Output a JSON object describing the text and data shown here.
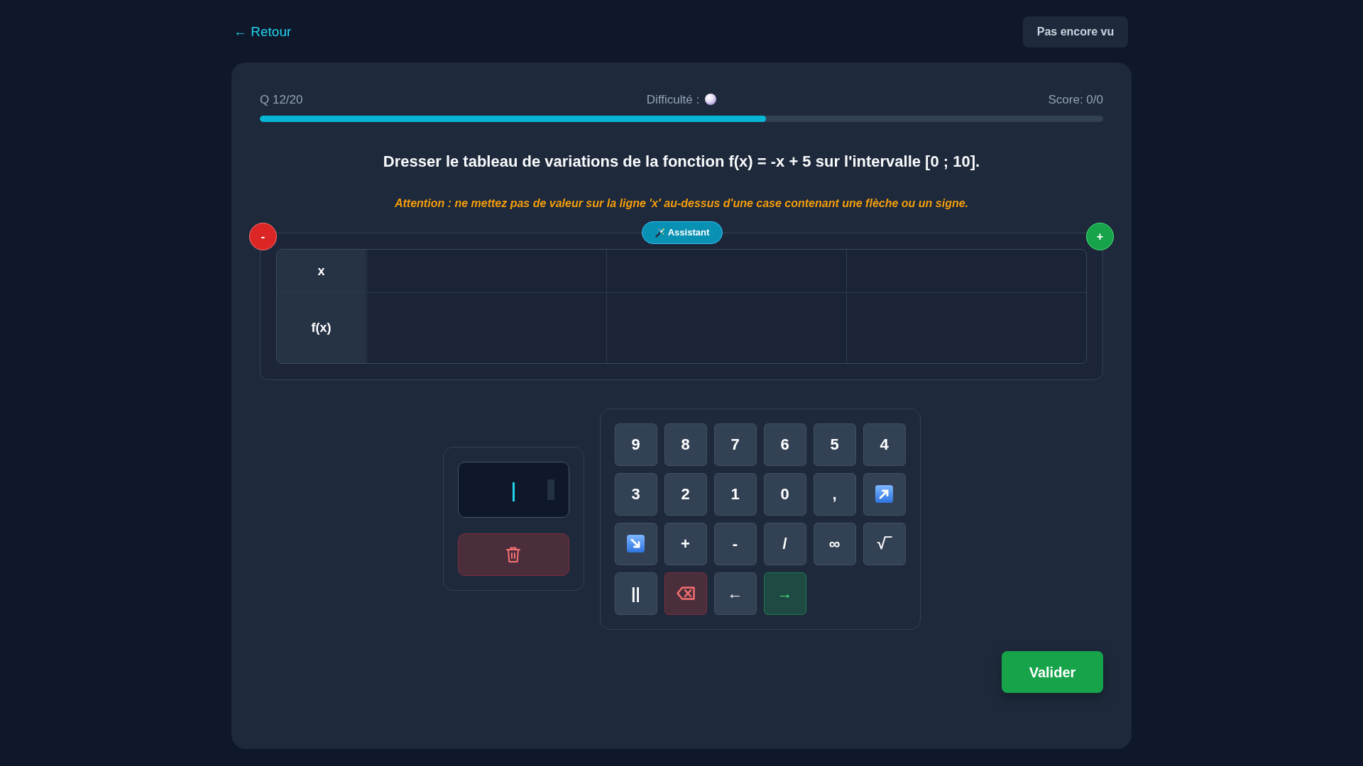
{
  "back_link": "← Retour",
  "status_button": "Pas encore vu",
  "progress": {
    "counter": "Q 12/20",
    "difficulty_label": "Difficulté :",
    "score": "Score: 0/0",
    "level": 0.6
  },
  "question": "Dresser le tableau de variations de la fonction f(x) = -x + 5 sur l'intervalle [0 ; 10].",
  "warning": "Attention : ne mettez pas de valeur sur la ligne 'x' au-dessus d'une case contenant une flèche ou un signe.",
  "table": {
    "remove_button": "-",
    "assistant_button": "Assistant",
    "add_button": "+",
    "rows": [
      {
        "kind": "values",
        "label": "x",
        "cells": [
          {
            "kind": "blank"
          },
          {
            "kind": "blank"
          },
          {
            "kind": "blank"
          }
        ]
      },
      {
        "kind": "variations",
        "label": "f(x)",
        "cells": [
          {
            "kind": "blank"
          },
          {
            "kind": "blank"
          },
          {
            "kind": "blank"
          }
        ]
      }
    ]
  },
  "keypad": {
    "keys": [
      {
        "kind": "plain",
        "label": "9"
      },
      {
        "kind": "plain",
        "label": "8"
      },
      {
        "kind": "plain",
        "label": "7"
      },
      {
        "kind": "plain",
        "label": "6"
      },
      {
        "kind": "plain",
        "label": "5"
      },
      {
        "kind": "plain",
        "label": "4"
      },
      {
        "kind": "plain",
        "label": "3"
      },
      {
        "kind": "plain",
        "label": "2"
      },
      {
        "kind": "plain",
        "label": "1"
      },
      {
        "kind": "plain",
        "label": "0"
      },
      {
        "kind": "plain",
        "label": ","
      },
      {
        "kind": "rise"
      },
      {
        "kind": "fall"
      },
      {
        "kind": "plain",
        "label": "+"
      },
      {
        "kind": "plain",
        "label": "-"
      },
      {
        "kind": "plain",
        "label": "/"
      },
      {
        "kind": "plain",
        "label": "∞"
      },
      {
        "kind": "plain",
        "label": "√‾"
      },
      {
        "kind": "plain",
        "label": "||"
      },
      {
        "kind": "erase"
      },
      {
        "kind": "plain",
        "label": "←"
      },
      {
        "kind": "next",
        "label": "→"
      }
    ]
  },
  "submit_button": "Valider"
}
